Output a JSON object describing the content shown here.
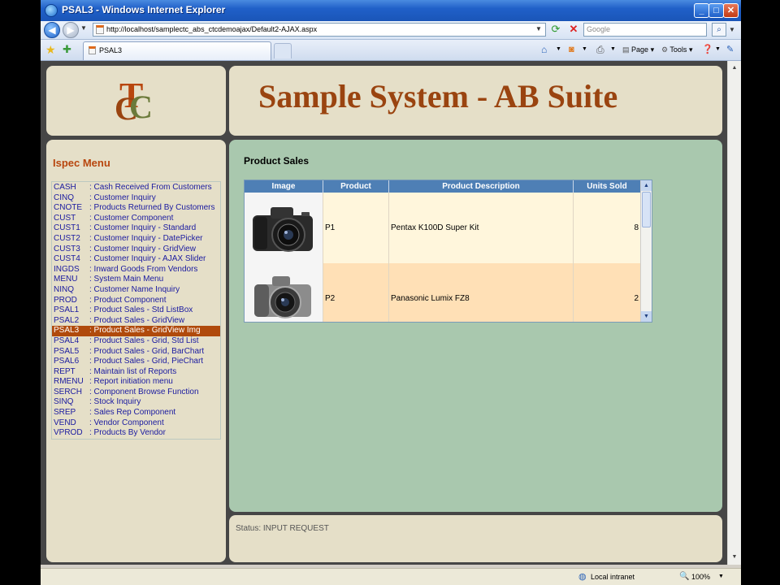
{
  "window": {
    "title": "PSAL3 - Windows Internet Explorer"
  },
  "browser": {
    "url": "http://localhost/samplectc_abs_ctcdemoajax/Default2-AJAX.aspx",
    "search_placeholder": "Google",
    "tab_title": "PSAL3",
    "tools": {
      "page": "Page",
      "tools": "Tools"
    }
  },
  "logo": {
    "letters": [
      "T",
      "C",
      "C"
    ]
  },
  "header": {
    "title": "Sample System - AB Suite"
  },
  "menu": {
    "title": "Ispec Menu",
    "items": [
      {
        "code": "CASH",
        "label": ": Cash Received From Customers"
      },
      {
        "code": "CINQ",
        "label": ": Customer Inquiry"
      },
      {
        "code": "CNOTE",
        "label": ": Products Returned By Customers"
      },
      {
        "code": "CUST",
        "label": ": Customer Component"
      },
      {
        "code": "CUST1",
        "label": ": Customer Inquiry - Standard"
      },
      {
        "code": "CUST2",
        "label": ": Customer Inquiry - DatePicker"
      },
      {
        "code": "CUST3",
        "label": ": Customer Inquiry - GridView"
      },
      {
        "code": "CUST4",
        "label": ": Customer Inquiry - AJAX Slider"
      },
      {
        "code": "INGDS",
        "label": ": Inward Goods From Vendors"
      },
      {
        "code": "MENU",
        "label": ": System Main Menu"
      },
      {
        "code": "NINQ",
        "label": ": Customer Name Inquiry"
      },
      {
        "code": "PROD",
        "label": ": Product Component"
      },
      {
        "code": "PSAL1",
        "label": ": Product Sales - Std ListBox"
      },
      {
        "code": "PSAL2",
        "label": ": Product Sales - GridView"
      },
      {
        "code": "PSAL3",
        "label": ": Product Sales - GridView Img"
      },
      {
        "code": "PSAL4",
        "label": ": Product Sales - Grid, Std List"
      },
      {
        "code": "PSAL5",
        "label": ": Product Sales - Grid, BarChart"
      },
      {
        "code": "PSAL6",
        "label": ": Product Sales - Grid, PieChart"
      },
      {
        "code": "REPT",
        "label": ": Maintain list of Reports"
      },
      {
        "code": "RMENU",
        "label": ": Report initiation menu"
      },
      {
        "code": "SERCH",
        "label": ": Component Browse Function"
      },
      {
        "code": "SINQ",
        "label": ": Stock Inquiry"
      },
      {
        "code": "SREP",
        "label": ": Sales Rep Component"
      },
      {
        "code": "VEND",
        "label": ": Vendor Component"
      },
      {
        "code": "VPROD",
        "label": ": Products By Vendor"
      }
    ]
  },
  "product_sales": {
    "title": "Product Sales",
    "columns": [
      "Image",
      "Product",
      "Product Description",
      "Units Sold"
    ],
    "rows": [
      {
        "product": "P1",
        "description": "Pentax K100D Super Kit",
        "units": "8"
      },
      {
        "product": "P2",
        "description": "Panasonic Lumix FZ8",
        "units": "2"
      }
    ]
  },
  "status": {
    "text": "Status: INPUT REQUEST"
  },
  "statusbar": {
    "zone": "Local intranet",
    "zoom": "100%"
  }
}
